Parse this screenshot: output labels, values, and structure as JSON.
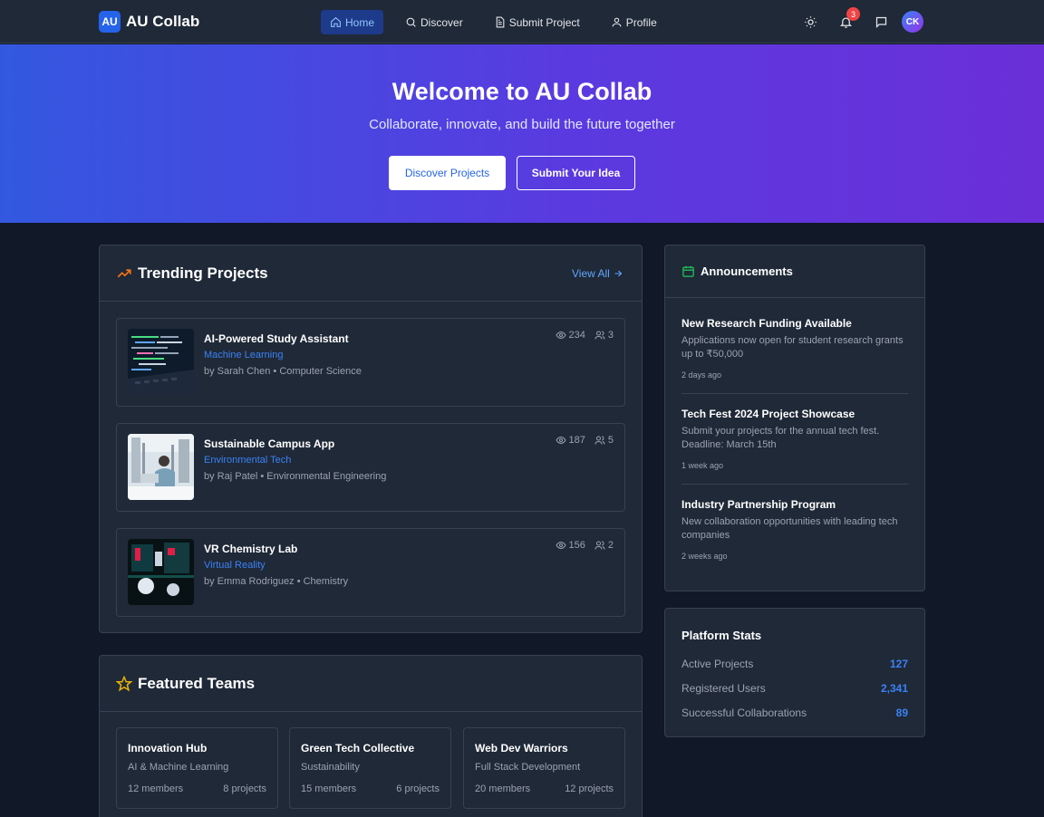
{
  "nav": {
    "logo_badge": "AU",
    "app_name": "AU Collab",
    "links": [
      {
        "label": "Home",
        "icon": "home-icon"
      },
      {
        "label": "Discover",
        "icon": "search-icon"
      },
      {
        "label": "Submit Project",
        "icon": "document-icon"
      },
      {
        "label": "Profile",
        "icon": "user-icon"
      }
    ],
    "notification_count": "3",
    "avatar_initials": "CK"
  },
  "hero": {
    "title": "Welcome to AU Collab",
    "subtitle": "Collaborate, innovate, and build the future together",
    "primary_button": "Discover Projects",
    "secondary_button": "Submit Your Idea"
  },
  "trending": {
    "title": "Trending Projects",
    "view_all": "View All",
    "projects": [
      {
        "title": "AI-Powered Study Assistant",
        "category": "Machine Learning",
        "byline": "by Sarah Chen • Computer Science",
        "views": "234",
        "members": "3"
      },
      {
        "title": "Sustainable Campus App",
        "category": "Environmental Tech",
        "byline": "by Raj Patel • Environmental Engineering",
        "views": "187",
        "members": "5"
      },
      {
        "title": "VR Chemistry Lab",
        "category": "Virtual Reality",
        "byline": "by Emma Rodriguez • Chemistry",
        "views": "156",
        "members": "2"
      }
    ]
  },
  "featured": {
    "title": "Featured Teams",
    "teams": [
      {
        "name": "Innovation Hub",
        "focus": "AI & Machine Learning",
        "members": "12 members",
        "projects": "8 projects"
      },
      {
        "name": "Green Tech Collective",
        "focus": "Sustainability",
        "members": "15 members",
        "projects": "6 projects"
      },
      {
        "name": "Web Dev Warriors",
        "focus": "Full Stack Development",
        "members": "20 members",
        "projects": "12 projects"
      }
    ]
  },
  "announcements": {
    "title": "Announcements",
    "items": [
      {
        "title": "New Research Funding Available",
        "description": "Applications now open for student research grants up to ₹50,000",
        "time": "2 days ago"
      },
      {
        "title": "Tech Fest 2024 Project Showcase",
        "description": "Submit your projects for the annual tech fest. Deadline: March 15th",
        "time": "1 week ago"
      },
      {
        "title": "Industry Partnership Program",
        "description": "New collaboration opportunities with leading tech companies",
        "time": "2 weeks ago"
      }
    ]
  },
  "stats": {
    "title": "Platform Stats",
    "rows": [
      {
        "label": "Active Projects",
        "value": "127"
      },
      {
        "label": "Registered Users",
        "value": "2,341"
      },
      {
        "label": "Successful Collaborations",
        "value": "89"
      }
    ]
  },
  "colors": {
    "accent": "#3b82f6",
    "background": "#111827",
    "card": "#1f2937",
    "hero_start": "#3358e0",
    "hero_end": "#6b2fd8"
  }
}
